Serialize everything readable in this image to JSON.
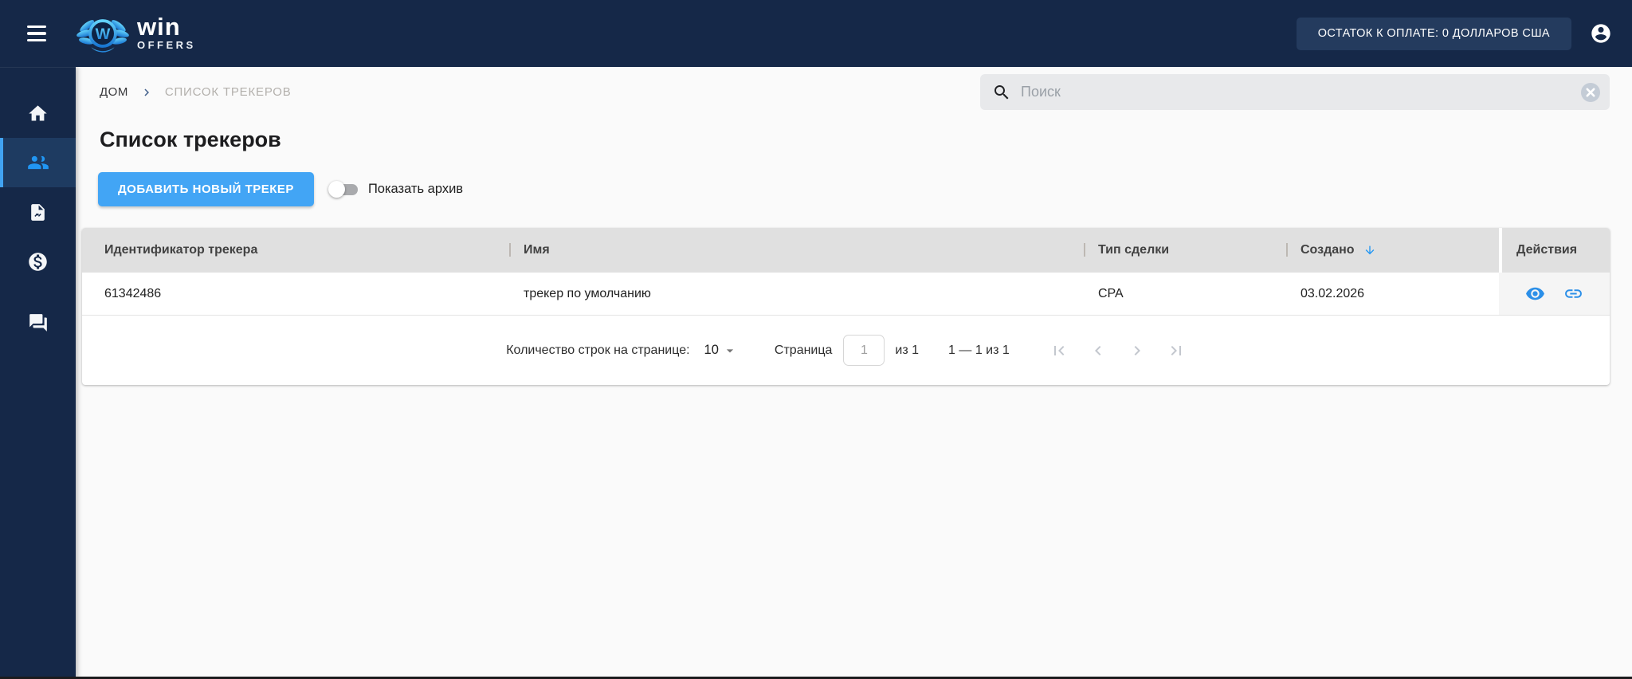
{
  "topbar": {
    "logo_title": "win",
    "logo_subtitle": "OFFERS",
    "balance_label": "ОСТАТОК К ОПЛАТЕ: 0 ДОЛЛАРОВ США"
  },
  "sidebar": {
    "items": [
      {
        "icon": "home-icon",
        "active": false
      },
      {
        "icon": "people-icon",
        "active": true
      },
      {
        "icon": "report-document-icon",
        "active": false
      },
      {
        "icon": "money-icon",
        "active": false
      },
      {
        "icon": "chat-icon",
        "active": false
      }
    ]
  },
  "breadcrumb": {
    "home": "ДОМ",
    "current": "СПИСОК ТРЕКЕРОВ"
  },
  "search": {
    "placeholder": "Поиск"
  },
  "page": {
    "title": "Список трекеров"
  },
  "controls": {
    "add_button": "ДОБАВИТЬ НОВЫЙ ТРЕКЕР",
    "archive_toggle_label": "Показать архив",
    "archive_toggle_on": false
  },
  "table": {
    "columns": [
      "Идентификатор трекера",
      "Имя",
      "Тип сделки",
      "Создано",
      "Действия"
    ],
    "sorted_column": "Создано",
    "sort_direction": "desc",
    "rows": [
      {
        "tracker_id": "61342486",
        "name": "трекер по умолчанию",
        "deal_type": "CPA",
        "created": "03.02.2026",
        "actions": [
          "view-eye-icon",
          "copy-link-icon"
        ]
      }
    ]
  },
  "pagination": {
    "rows_per_page_label": "Количество строк на странице:",
    "rows_per_page": "10",
    "page_label": "Страница",
    "page_value": "1",
    "of_label": "из 1",
    "range_label": "1 — 1 из 1"
  },
  "colors": {
    "navy": "#152848",
    "badge_navy": "#243b5e",
    "accent_blue": "#42a5f5",
    "icon_blue": "#2196f3",
    "table_header_gray": "#e0e0e0",
    "actions_cell_gray": "#f5f5f5",
    "page_bg": "#fafafa"
  }
}
